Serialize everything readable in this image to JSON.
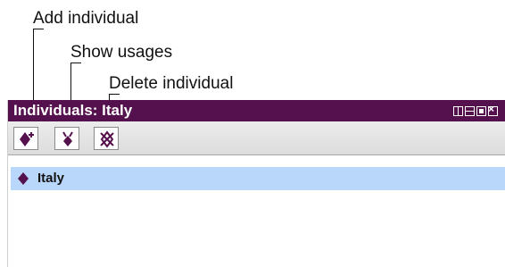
{
  "callouts": {
    "add": "Add individual",
    "usages": "Show usages",
    "delete": "Delete individual"
  },
  "window": {
    "title": "Individuals: Italy",
    "accent": "#55114d",
    "selection_color": "#b8d7fb",
    "controls": [
      "tile-icon",
      "minimize-icon",
      "maximize-icon",
      "close-icon"
    ]
  },
  "toolbar": {
    "buttons": [
      {
        "name": "add-individual",
        "icon": "diamond-plus-icon"
      },
      {
        "name": "show-usages",
        "icon": "diamond-arrow-icon"
      },
      {
        "name": "delete-individual",
        "icon": "diamond-cross-icon"
      }
    ]
  },
  "list": {
    "items": [
      {
        "label": "Italy",
        "icon": "diamond-icon",
        "selected": true
      }
    ]
  }
}
